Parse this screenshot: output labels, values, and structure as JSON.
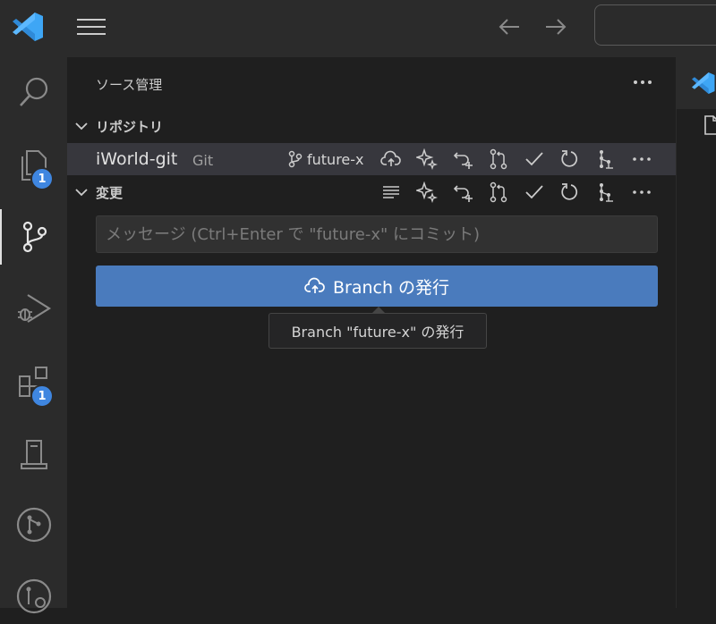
{
  "sidebar": {
    "title": "ソース管理",
    "sections": {
      "repositories_label": "リポジトリ",
      "changes_label": "変更"
    }
  },
  "repo": {
    "name": "iWorld-git",
    "type": "Git",
    "branch": "future-x"
  },
  "commit": {
    "placeholder": "メッセージ (Ctrl+Enter で \"future-x\" にコミット)"
  },
  "publish": {
    "label": "Branch の発行",
    "tooltip": "Branch \"future-x\" の発行"
  },
  "badges": {
    "explorer": "1",
    "extensions": "1"
  },
  "colors": {
    "accent": "#4a7bbd",
    "badge": "#3f86e0",
    "logo": "#3ea6f5",
    "selected_row": "#37373d"
  }
}
